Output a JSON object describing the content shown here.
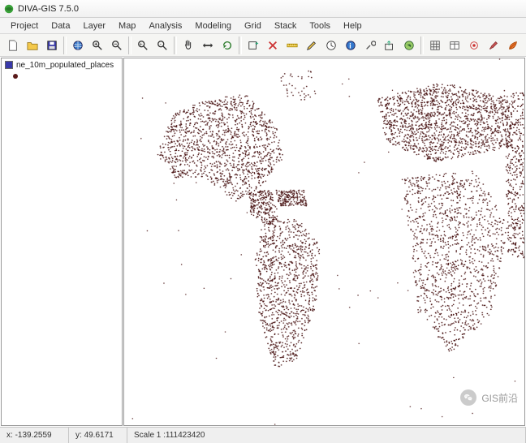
{
  "window": {
    "title": "DIVA-GIS 7.5.0"
  },
  "menu": {
    "items": [
      "Project",
      "Data",
      "Layer",
      "Map",
      "Analysis",
      "Modeling",
      "Grid",
      "Stack",
      "Tools",
      "Help"
    ]
  },
  "toolbar": {
    "icons": [
      "new-file-icon",
      "open-file-icon",
      "save-icon",
      "sep",
      "globe-icon",
      "zoom-icon",
      "zoom-out-icon",
      "sep",
      "zoom-in-icon",
      "magnify-icon",
      "sep",
      "pan-icon",
      "arrows-h-icon",
      "refresh-icon",
      "sep",
      "add-layer-icon",
      "remove-layer-icon",
      "ruler-icon",
      "pencil-icon",
      "clock-icon",
      "info-icon",
      "tools-icon",
      "export-icon",
      "world-icon",
      "sep",
      "grid-icon",
      "table-icon",
      "target-icon",
      "brush-icon",
      "leaf-icon"
    ]
  },
  "layers": {
    "items": [
      {
        "name": "ne_10m_populated_places",
        "color": "#3a3aaa",
        "symbol_color": "#5a1a1a"
      }
    ]
  },
  "status": {
    "x_label": "x:",
    "x_value": "-139.2559",
    "y_label": "y:",
    "y_value": "49.6171",
    "scale_label": "Scale 1 :",
    "scale_value": "111423420"
  },
  "watermark": {
    "text": "GIS前沿"
  },
  "map": {
    "point_color": "#4a1515",
    "point_radius": 1.6
  }
}
